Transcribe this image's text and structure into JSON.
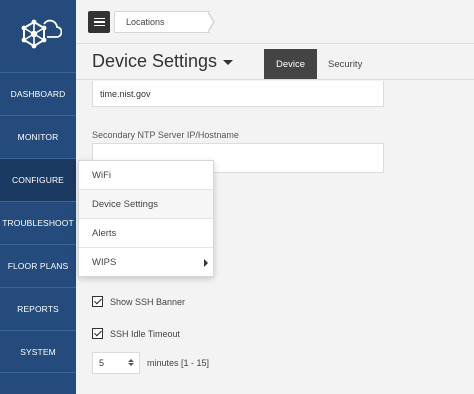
{
  "sidebar": {
    "logo": "cloud-network-logo",
    "items": [
      {
        "label": "DASHBOARD",
        "active": false
      },
      {
        "label": "MONITOR",
        "active": false
      },
      {
        "label": "CONFIGURE",
        "active": true
      },
      {
        "label": "TROUBLESHOOT",
        "active": false
      },
      {
        "label": "FLOOR PLANS",
        "active": false
      },
      {
        "label": "REPORTS",
        "active": false
      },
      {
        "label": "SYSTEM",
        "active": false
      }
    ],
    "colors": {
      "background": "#244b7c",
      "active": "#1b3a61"
    }
  },
  "topbar": {
    "breadcrumb": "Locations"
  },
  "header": {
    "title": "Device Settings",
    "tabs": [
      {
        "label": "Device",
        "active": true
      },
      {
        "label": "Security",
        "active": false
      }
    ]
  },
  "form": {
    "primary_ntp_value": "time.nist.gov",
    "secondary_ntp_label": "Secondary NTP Server IP/Hostname",
    "secondary_ntp_value": "",
    "show_ssh_banner_label": "Show SSH Banner",
    "show_ssh_banner_checked": true,
    "ssh_idle_timeout_label": "SSH Idle Timeout",
    "ssh_idle_timeout_checked": true,
    "timeout_value": "5",
    "timeout_range": "minutes [1 - 15]"
  },
  "configure_menu": {
    "items": [
      {
        "label": "WiFi",
        "has_submenu": false
      },
      {
        "label": "Device Settings",
        "has_submenu": false
      },
      {
        "label": "Alerts",
        "has_submenu": false
      },
      {
        "label": "WIPS",
        "has_submenu": true
      }
    ]
  }
}
